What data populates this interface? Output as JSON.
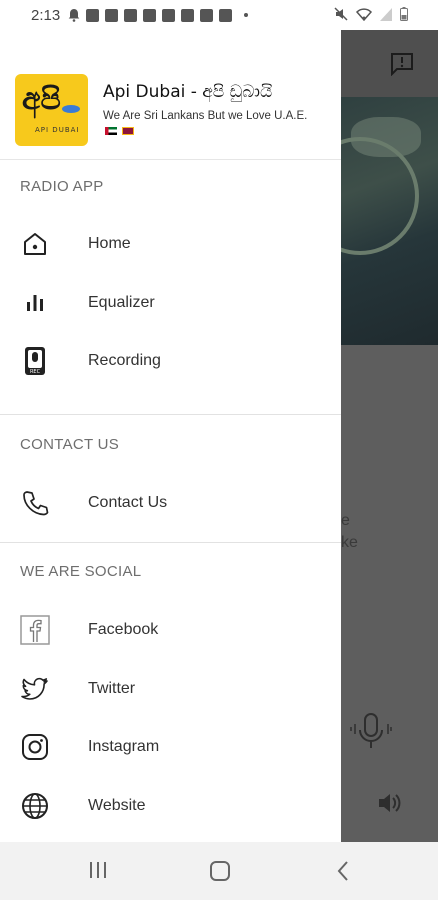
{
  "status_bar": {
    "time": "2:13"
  },
  "header": {
    "logo_text": "අපි",
    "logo_subtext": "API DUBAI",
    "app_title": "Api Dubai - අපි ඩුබායි",
    "tagline": "We Are Sri Lankans But we Love U.A.E."
  },
  "sections": [
    {
      "title": "RADIO APP",
      "items": [
        {
          "label": "Home",
          "icon": "home-icon"
        },
        {
          "label": "Equalizer",
          "icon": "equalizer-icon"
        },
        {
          "label": "Recording",
          "icon": "recording-icon"
        }
      ]
    },
    {
      "title": "CONTACT US",
      "items": [
        {
          "label": "Contact Us",
          "icon": "phone-icon"
        }
      ]
    },
    {
      "title": "WE ARE SOCIAL",
      "items": [
        {
          "label": "Facebook",
          "icon": "facebook-icon"
        },
        {
          "label": "Twitter",
          "icon": "twitter-icon"
        },
        {
          "label": "Instagram",
          "icon": "instagram-icon"
        },
        {
          "label": "Website",
          "icon": "globe-icon"
        }
      ]
    }
  ],
  "background": {
    "text_lines": [
      "e",
      "ke"
    ]
  },
  "colors": {
    "logo_bg": "#f7c91c",
    "scrim": "#5e5e5e"
  }
}
